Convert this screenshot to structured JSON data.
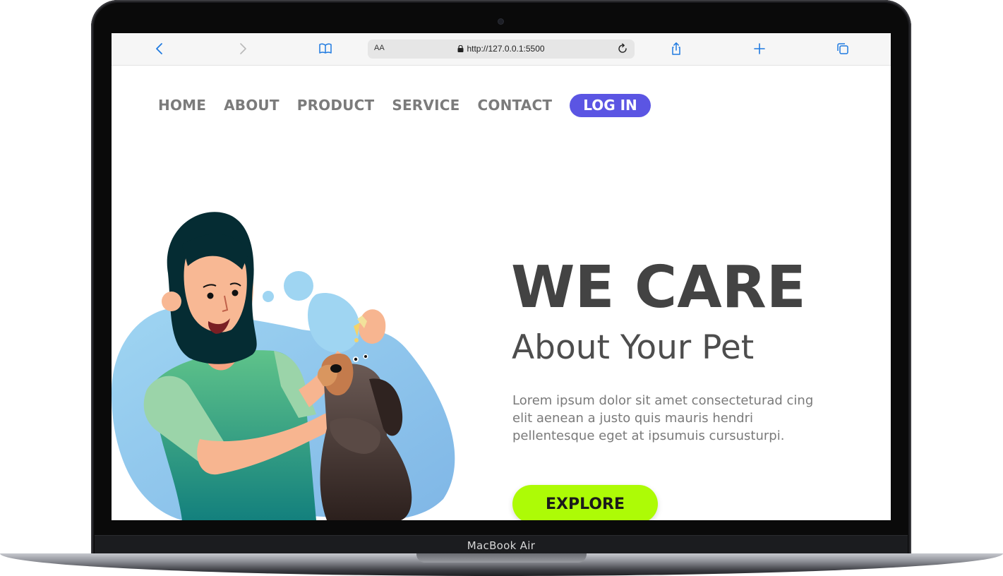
{
  "device": {
    "label": "MacBook Air"
  },
  "browser": {
    "text_size_label": "AA",
    "url": "http://127.0.0.1:5500",
    "icons": [
      "back-icon",
      "forward-icon",
      "bookmarks-icon",
      "lock-icon",
      "reload-icon",
      "share-icon",
      "new-tab-icon",
      "tabs-icon"
    ]
  },
  "nav": {
    "items": [
      "HOME",
      "ABOUT",
      "PRODUCT",
      "SERVICE",
      "CONTACT"
    ],
    "login": "LOG IN"
  },
  "hero": {
    "title": "WE CARE",
    "subtitle": "About Your Pet",
    "description": "Lorem ipsum dolor sit amet consecteturad cing elit aenean a justo quis mauris hendri pellentesque eget at ipsumuis cursusturpi.",
    "cta": "EXPLORE"
  },
  "colors": {
    "accent": "#5b55e3",
    "cta": "#adfb06",
    "title": "#434343",
    "nav_text": "#7b7b7b"
  }
}
